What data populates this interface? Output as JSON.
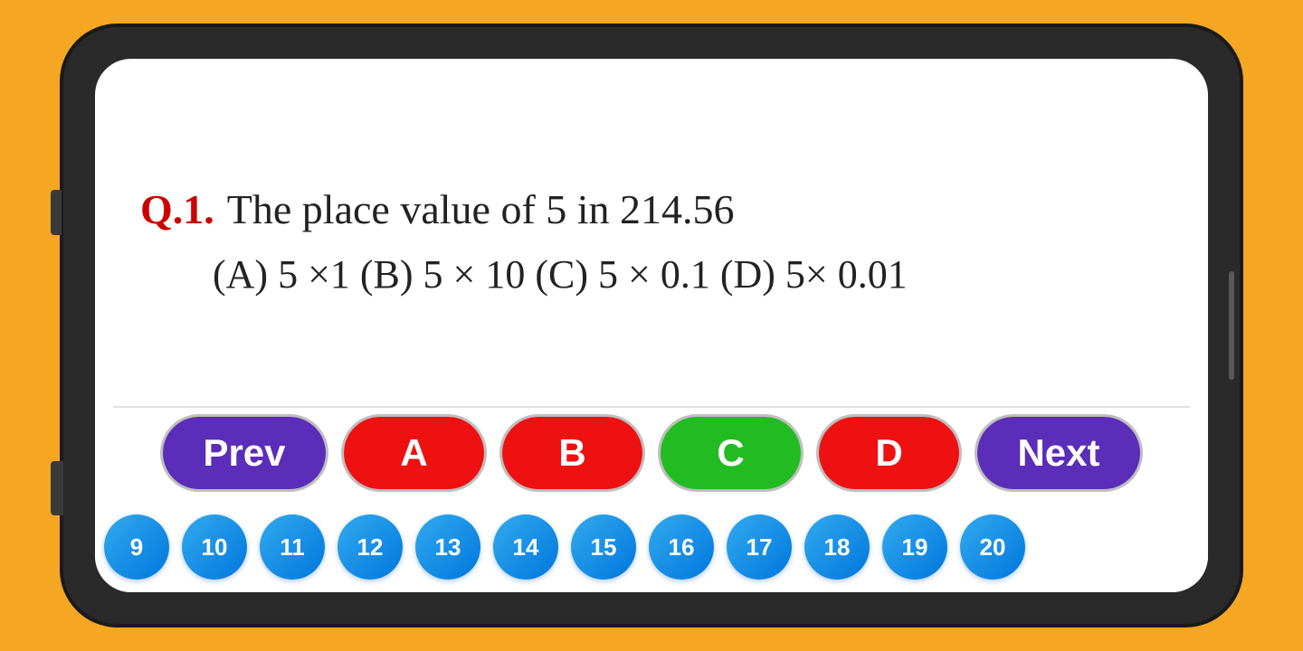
{
  "background_color": "#F5A623",
  "question": {
    "number": "Q.1.",
    "text": "The place value of 5 in 214.56",
    "options_text": "(A) 5 ×1    (B) 5 × 10      (C) 5 × 0.1   (D) 5× 0.01"
  },
  "buttons": {
    "prev_label": "Prev",
    "a_label": "A",
    "b_label": "B",
    "c_label": "C",
    "d_label": "D",
    "next_label": "Next"
  },
  "number_circles": [
    9,
    10,
    11,
    12,
    13,
    14,
    15,
    16,
    17,
    18,
    19,
    20
  ]
}
